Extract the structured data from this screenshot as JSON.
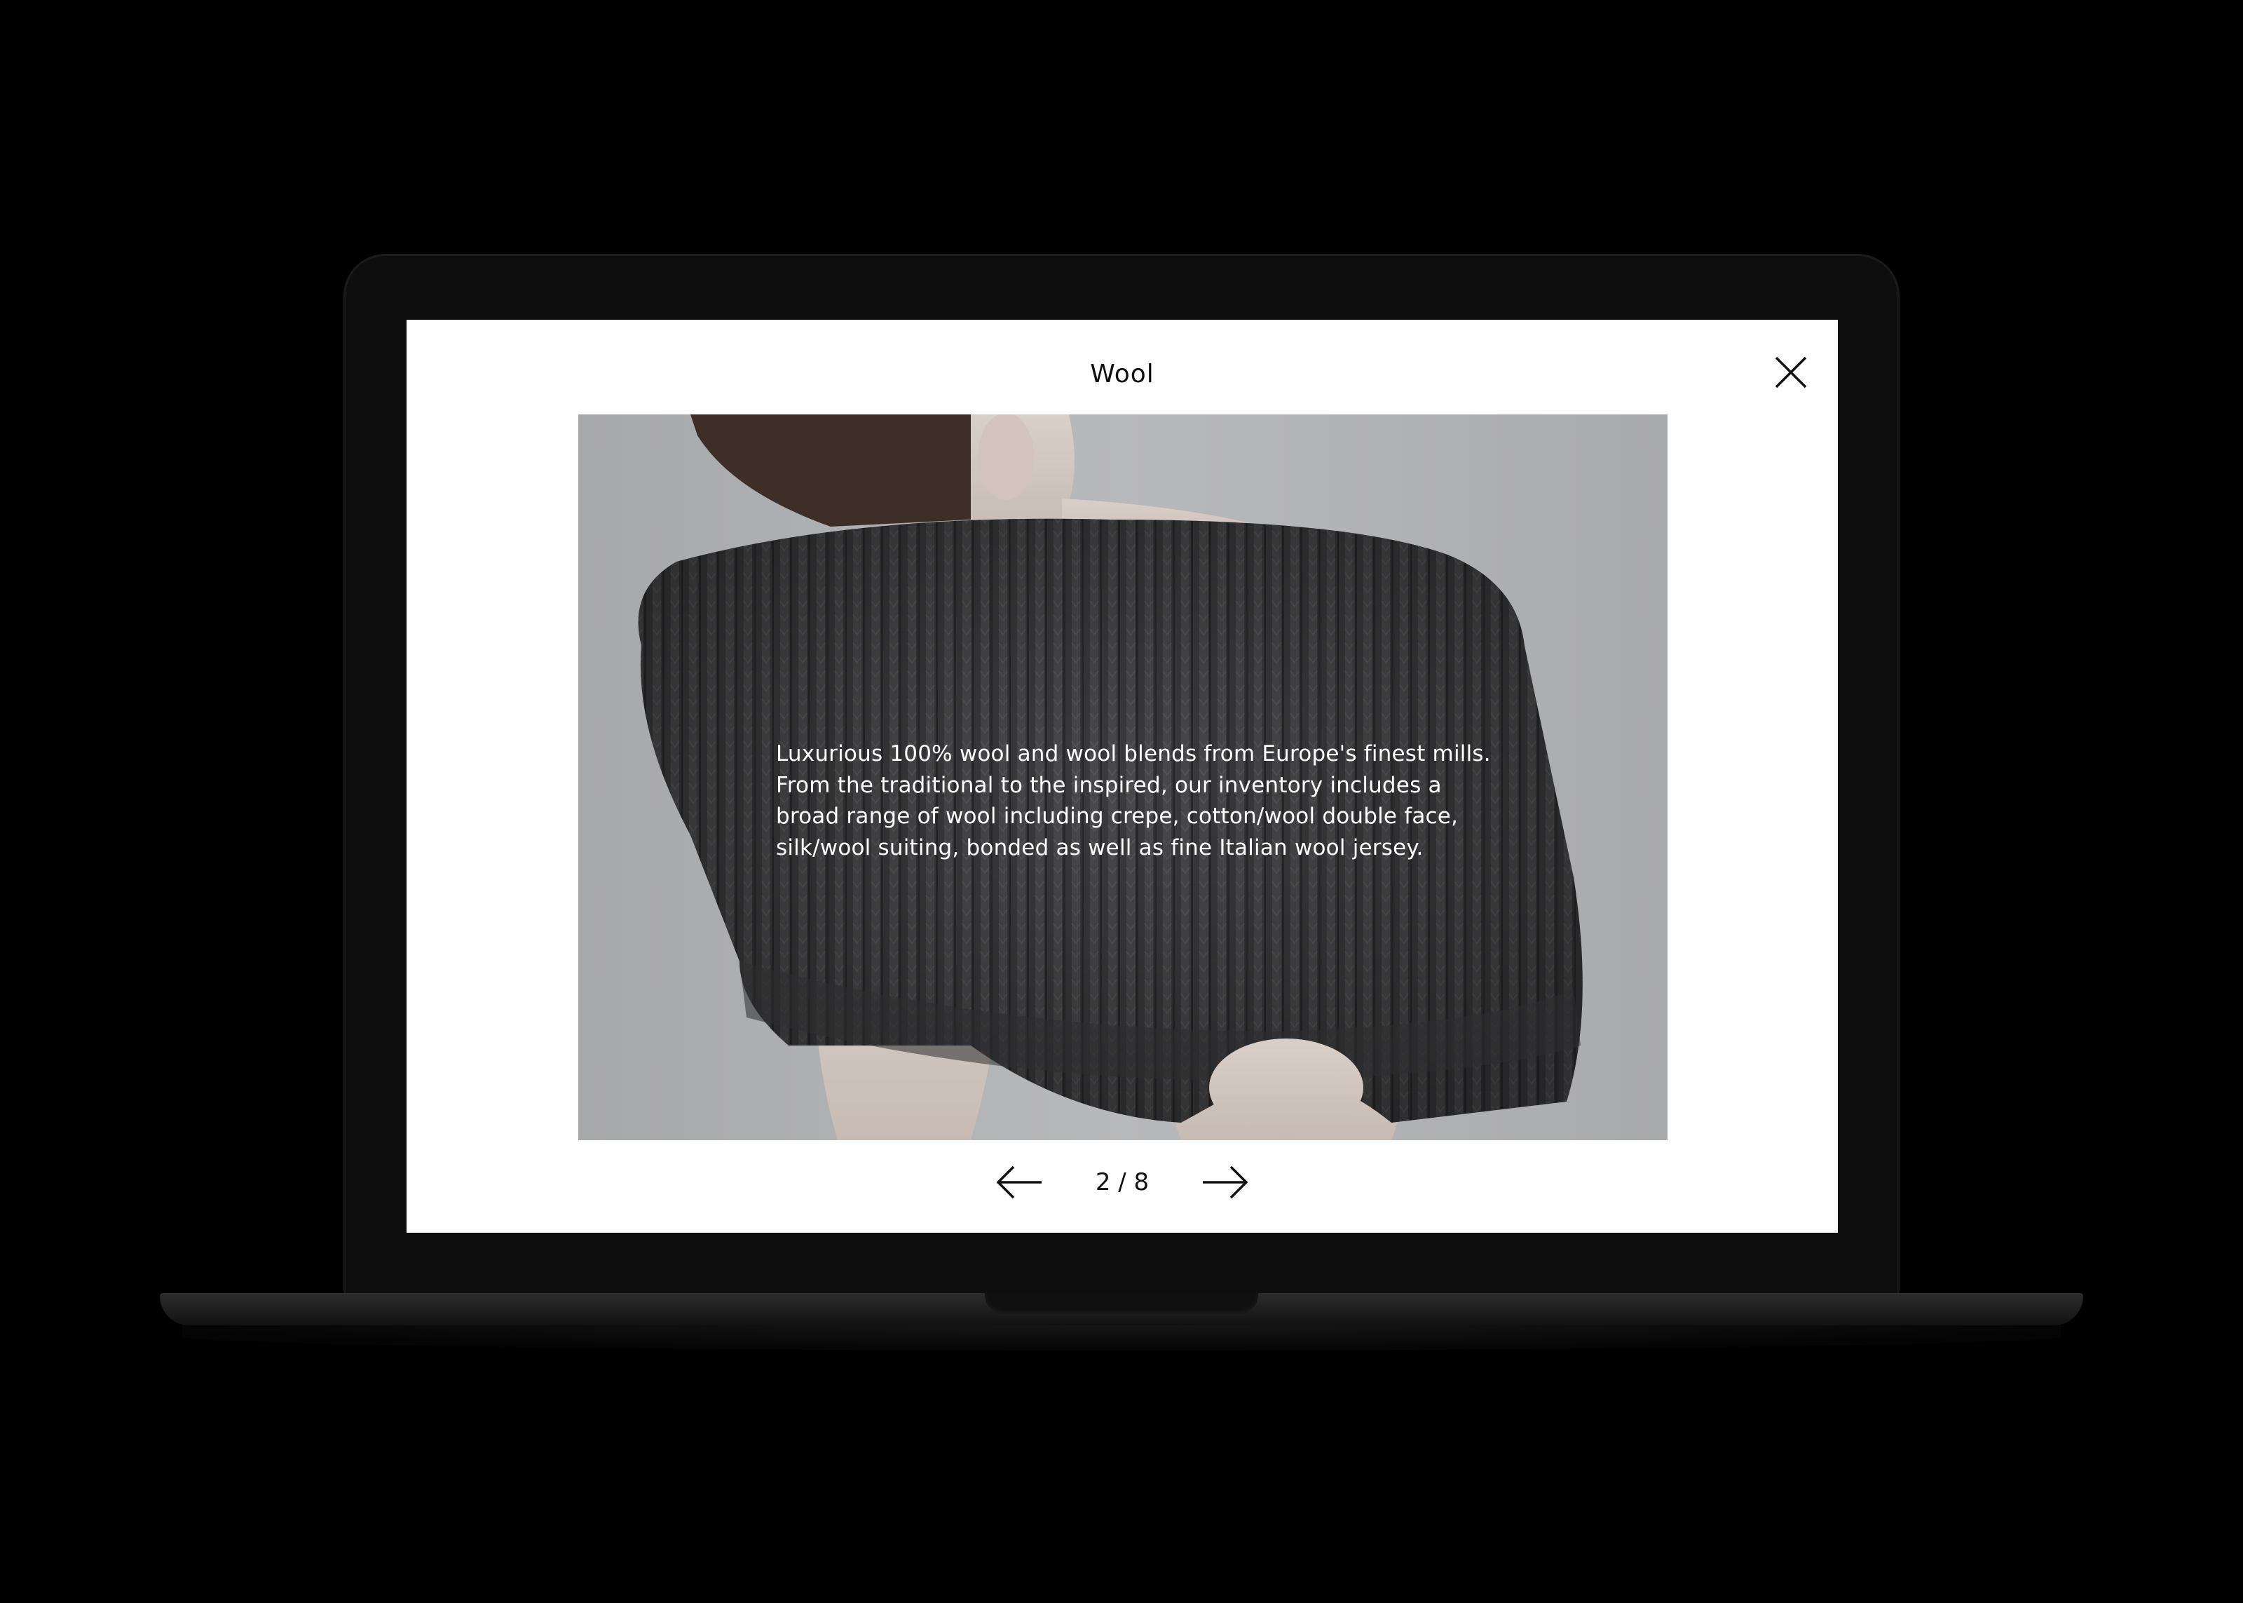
{
  "modal": {
    "title": "Wool",
    "close_icon": "close-icon"
  },
  "slide": {
    "caption": "Luxurious 100% wool and wool blends from Europe's finest mills.\nFrom the traditional to the inspired, our inventory includes a\nbroad range of wool including crepe, cotton/wool double face,\nsilk/wool suiting, bonded as well as fine Italian wool jersey.",
    "image_subject": "ribbed knit wool sweater"
  },
  "pager": {
    "current": 2,
    "total": 8,
    "label": "2 / 8",
    "prev_icon": "arrow-left-icon",
    "next_icon": "arrow-right-icon"
  },
  "colors": {
    "background": "#000000",
    "screen": "#ffffff",
    "text": "#111111",
    "caption_text": "#ffffff",
    "photo_backdrop": "#b0b1b3",
    "knit": "#3a3a3c"
  }
}
